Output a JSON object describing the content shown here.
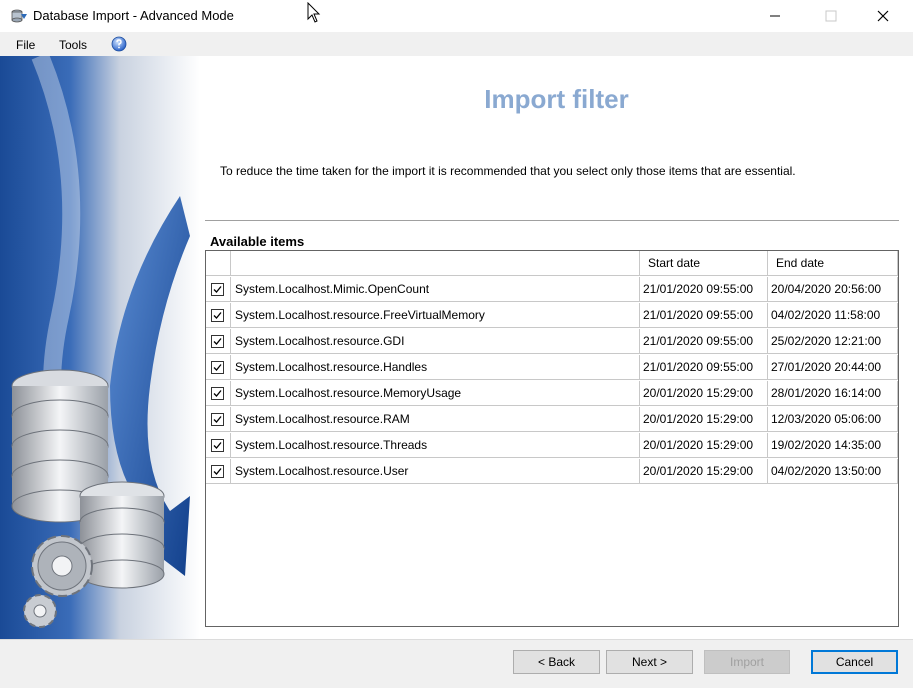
{
  "window": {
    "title": "Database Import - Advanced Mode"
  },
  "menu": {
    "file": "File",
    "tools": "Tools"
  },
  "content": {
    "title": "Import filter",
    "instruction": "To reduce the time taken for the import it is recommended that you select only those items that are essential.",
    "available_label": "Available items"
  },
  "table": {
    "columns": [
      "",
      "Start date",
      "End date"
    ],
    "rows": [
      {
        "checked": true,
        "name": "System.Localhost.Mimic.OpenCount",
        "start": "21/01/2020 09:55:00",
        "end": "20/04/2020 20:56:00"
      },
      {
        "checked": true,
        "name": "System.Localhost.resource.FreeVirtualMemory",
        "start": "21/01/2020 09:55:00",
        "end": "04/02/2020 11:58:00"
      },
      {
        "checked": true,
        "name": "System.Localhost.resource.GDI",
        "start": "21/01/2020 09:55:00",
        "end": "25/02/2020 12:21:00"
      },
      {
        "checked": true,
        "name": "System.Localhost.resource.Handles",
        "start": "21/01/2020 09:55:00",
        "end": "27/01/2020 20:44:00"
      },
      {
        "checked": true,
        "name": "System.Localhost.resource.MemoryUsage",
        "start": "20/01/2020 15:29:00",
        "end": "28/01/2020 16:14:00"
      },
      {
        "checked": true,
        "name": "System.Localhost.resource.RAM",
        "start": "20/01/2020 15:29:00",
        "end": "12/03/2020 05:06:00"
      },
      {
        "checked": true,
        "name": "System.Localhost.resource.Threads",
        "start": "20/01/2020 15:29:00",
        "end": "19/02/2020 14:35:00"
      },
      {
        "checked": true,
        "name": "System.Localhost.resource.User",
        "start": "20/01/2020 15:29:00",
        "end": "04/02/2020 13:50:00"
      }
    ]
  },
  "buttons": {
    "back": "< Back",
    "next": "Next >",
    "import": "Import",
    "cancel": "Cancel"
  },
  "icons": {
    "app": "database-import-icon",
    "help": "help-icon",
    "cursor": "mouse-cursor-icon"
  },
  "colors": {
    "title_accent": "#8aa9d1",
    "sidebar_blue": "#1c4f9c",
    "default_button_border": "#0078d7"
  }
}
